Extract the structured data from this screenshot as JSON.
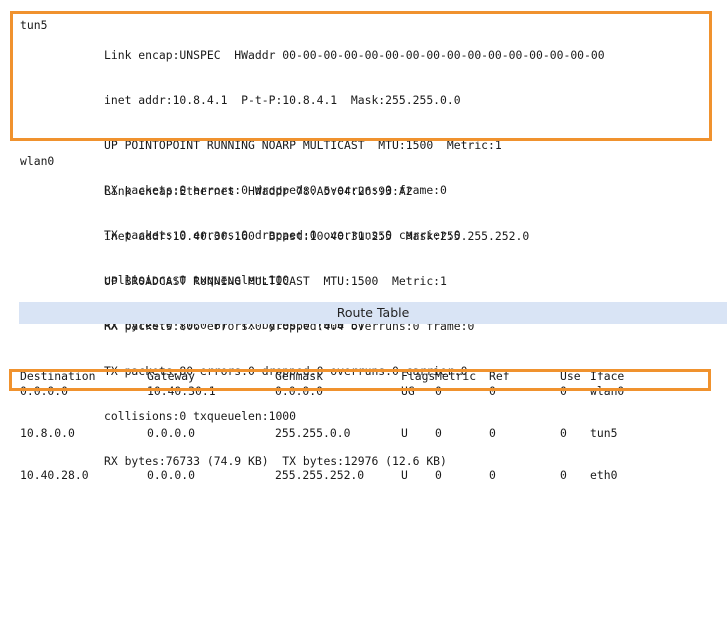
{
  "interfaces": [
    {
      "name": "tun5",
      "lines": [
        "Link encap:UNSPEC  HWaddr 00-00-00-00-00-00-00-00-00-00-00-00-00-00-00-00",
        "inet addr:10.8.4.1  P-t-P:10.8.4.1  Mask:255.255.0.0",
        "UP POINTOPOINT RUNNING NOARP MULTICAST  MTU:1500  Metric:1",
        "RX packets:0 errors:0 dropped:0 overruns:0 frame:0",
        "TX packets:0 errors:0 dropped:0 overruns:0 carrier:0",
        "collisions:0 txqueuelen:100",
        "RX bytes:0 (0.0 B)  TX bytes:0 (0.0 B)"
      ]
    },
    {
      "name": "wlan0",
      "lines": [
        "Link encap:Ethernet  HWaddr 78:A5:04:26:93:A2",
        "inet addr:10.40.30.160  Bcast:10.40.31.255  Mask:255.255.252.0",
        "UP BROADCAST RUNNING MULTICAST  MTU:1500  Metric:1",
        "RX packets:806 errors:0 dropped:404 overruns:0 frame:0",
        "TX packets:80 errors:0 dropped:0 overruns:0 carrier:0",
        "collisions:0 txqueuelen:1000",
        "RX bytes:76733 (74.9 KB)  TX bytes:12976 (12.6 KB)"
      ]
    }
  ],
  "route_table": {
    "title": "Route Table",
    "headers": {
      "destination": "Destination",
      "gateway": "Gateway",
      "genmask": "Genmask",
      "flags": "Flags",
      "metric": "Metric",
      "ref": "Ref",
      "use": "Use",
      "iface": "Iface"
    },
    "rows": [
      {
        "destination": "0.0.0.0",
        "gateway": "10.40.30.1",
        "genmask": "0.0.0.0",
        "flags": "UG",
        "metric": "0",
        "ref": "0",
        "use": "0",
        "iface": "wlan0"
      },
      {
        "destination": "10.8.0.0",
        "gateway": "0.0.0.0",
        "genmask": "255.255.0.0",
        "flags": "U",
        "metric": "0",
        "ref": "0",
        "use": "0",
        "iface": "tun5"
      },
      {
        "destination": "10.40.28.0",
        "gateway": "0.0.0.0",
        "genmask": "255.255.252.0",
        "flags": "U",
        "metric": "0",
        "ref": "0",
        "use": "0",
        "iface": "eth0"
      }
    ]
  },
  "highlight_color": "#f0922e",
  "header_bar_color": "#d9e4f5"
}
